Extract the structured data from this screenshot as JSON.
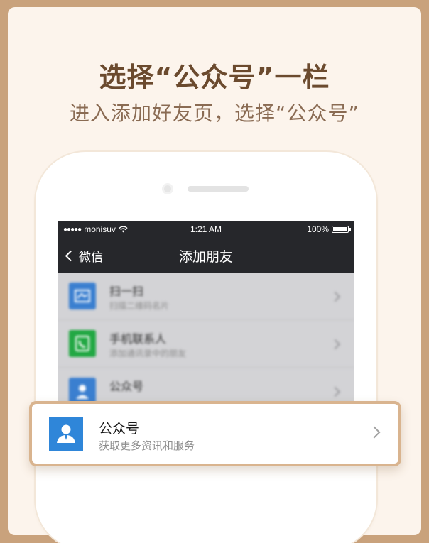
{
  "header": {
    "title": "选择“公众号”一栏",
    "subtitle": "进入添加好友页，选择“公众号”"
  },
  "statusbar": {
    "carrier": "monisuv",
    "time": "1:21 AM",
    "battery": "100%"
  },
  "navbar": {
    "back_label": "微信",
    "title": "添加朋友"
  },
  "list": [
    {
      "title": "扫一扫",
      "desc": "扫描二维码名片",
      "icon": "scan-icon",
      "color": "#3a7fd0"
    },
    {
      "title": "手机联系人",
      "desc": "添加通讯录中的朋友",
      "icon": "phone-contacts-icon",
      "color": "#22a843"
    },
    {
      "title": "公众号",
      "desc": "",
      "icon": "official-account-icon",
      "color": "#3a7fd0"
    }
  ],
  "popup": {
    "title": "公众号",
    "desc": "获取更多资讯和服务",
    "icon": "official-account-icon",
    "color": "#2f86d9"
  },
  "colors": {
    "background": "#c9a27c",
    "card": "#fcf4ec",
    "title": "#6b4a2e",
    "subtitle": "#8a6b53",
    "navbar": "#26272b",
    "highlight_border": "#d9b48f"
  }
}
